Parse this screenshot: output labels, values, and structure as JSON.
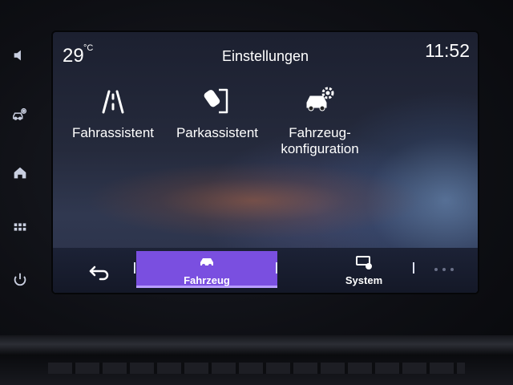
{
  "status": {
    "temperature": "29",
    "temperature_unit": "°C",
    "clock": "11:52"
  },
  "header": {
    "title": "Einstellungen"
  },
  "tiles": [
    {
      "label": "Fahrassistent",
      "icon": "lane-assist-icon"
    },
    {
      "label": "Parkassistent",
      "icon": "parking-assist-icon"
    },
    {
      "label_line1": "Fahrzeug-",
      "label_line2": "konfiguration",
      "icon": "vehicle-settings-icon"
    }
  ],
  "navbar": {
    "back_icon": "back-arrow-icon",
    "tabs": [
      {
        "label": "Fahrzeug",
        "icon": "car-icon",
        "active": true
      },
      {
        "label": "System",
        "icon": "system-settings-icon",
        "active": false
      }
    ],
    "more_icon": "more-dots-icon",
    "active_color": "#7a4fe0"
  },
  "side_rail": {
    "buttons": [
      "volume-icon",
      "vehicle-settings-icon",
      "home-icon",
      "apps-grid-icon",
      "power-icon"
    ]
  }
}
